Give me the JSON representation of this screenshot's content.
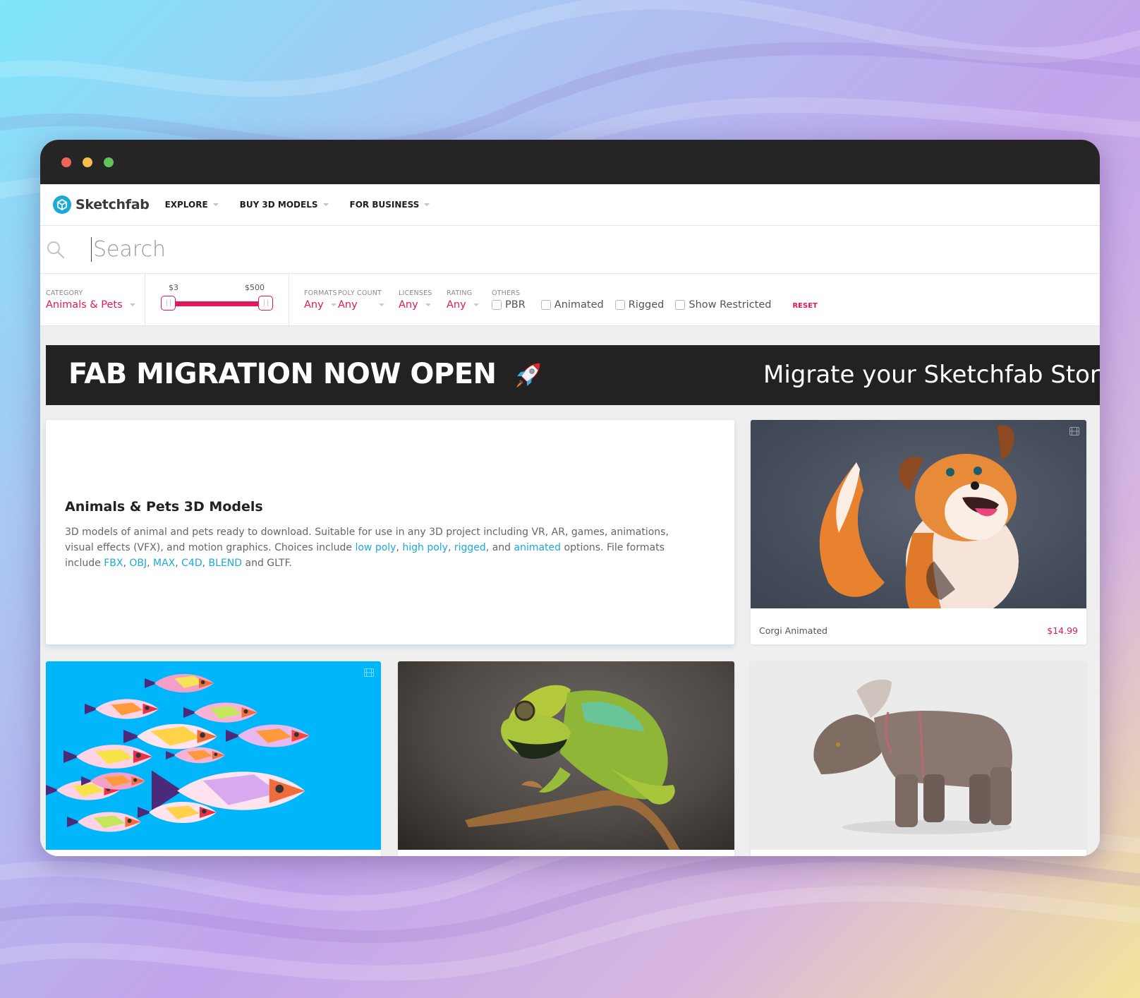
{
  "window": {
    "controls": [
      "close",
      "minimize",
      "maximize"
    ]
  },
  "nav": {
    "logo_text": "Sketchfab",
    "items": [
      {
        "label": "EXPLORE"
      },
      {
        "label": "BUY 3D MODELS"
      },
      {
        "label": "FOR BUSINESS"
      }
    ]
  },
  "search": {
    "placeholder": "Search",
    "value": ""
  },
  "filters": {
    "category": {
      "label": "CATEGORY",
      "value": "Animals & Pets"
    },
    "price": {
      "min_label": "$3",
      "max_label": "$500",
      "min": 3,
      "max": 500
    },
    "formats": {
      "label": "FORMATS",
      "value": "Any"
    },
    "poly_count": {
      "label": "POLY COUNT",
      "value": "Any"
    },
    "licenses": {
      "label": "LICENSES",
      "value": "Any"
    },
    "rating": {
      "label": "RATING",
      "value": "Any"
    },
    "others": {
      "label": "OTHERS",
      "options": [
        {
          "label": "PBR",
          "checked": false
        },
        {
          "label": "Animated",
          "checked": false
        },
        {
          "label": "Rigged",
          "checked": false
        },
        {
          "label": "Show Restricted",
          "checked": false
        }
      ]
    },
    "reset_label": "RESET"
  },
  "banner": {
    "title": "FAB MIGRATION NOW OPEN",
    "icon": "rocket-icon",
    "subtitle": "Migrate your Sketchfab Store Ass"
  },
  "description": {
    "title": "Animals & Pets 3D Models",
    "text_1": "3D models of animal and pets ready to download. Suitable for use in any 3D project including VR, AR, games, animations, visual effects (VFX), and motion graphics. Choices include ",
    "link_low_poly": "low poly",
    "sep_1": ", ",
    "link_high_poly": "high poly",
    "sep_2": ", ",
    "link_rigged": "rigged",
    "sep_3": ", and ",
    "link_animated": "animated",
    "text_2": " options. File formats include ",
    "link_fbx": "FBX",
    "sep_4": ", ",
    "link_obj": "OBJ",
    "sep_5": ", ",
    "link_max": "MAX",
    "sep_6": ", ",
    "link_c4d": "C4D",
    "sep_7": ", ",
    "link_blend": "BLEND",
    "text_3": " and GLTF."
  },
  "models": [
    {
      "name": "Corgi Animated",
      "price": "$14.99",
      "animated": true
    },
    {
      "name": "",
      "price": "",
      "animated": true
    },
    {
      "name": "",
      "price": "",
      "animated": false
    },
    {
      "name": "",
      "price": "",
      "animated": false
    }
  ],
  "colors": {
    "accent": "#e0195c",
    "link": "#1caad9",
    "brand": "#1caad9"
  }
}
